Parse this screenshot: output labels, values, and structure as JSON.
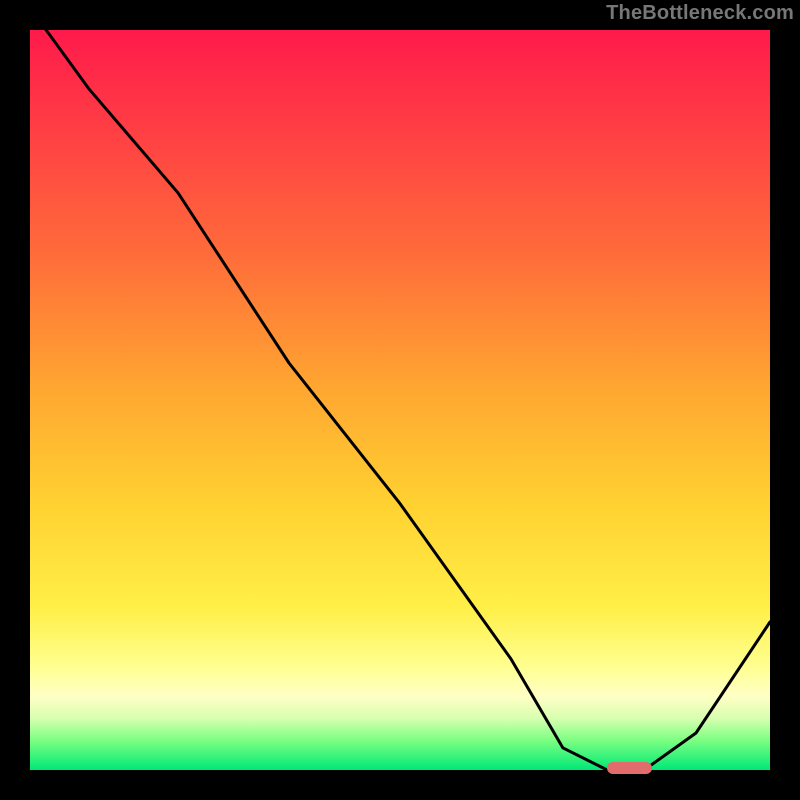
{
  "watermark": "TheBottleneck.com",
  "colors": {
    "background": "#000000",
    "gradient_top": "#ff1a4b",
    "gradient_mid1": "#ff6b3a",
    "gradient_mid2": "#ffd131",
    "gradient_mid3": "#ffff90",
    "gradient_bottom": "#00e876",
    "curve": "#000000",
    "marker": "#e26b6b"
  },
  "chart_data": {
    "type": "line",
    "title": "",
    "xlabel": "",
    "ylabel": "",
    "xlim": [
      0,
      100
    ],
    "ylim": [
      0,
      100
    ],
    "legend": false,
    "grid": false,
    "series": [
      {
        "name": "bottleneck-curve",
        "x": [
          0,
          8,
          20,
          35,
          50,
          65,
          72,
          78,
          83,
          90,
          100
        ],
        "values": [
          103,
          92,
          78,
          55,
          36,
          15,
          3,
          0,
          0,
          5,
          20
        ]
      }
    ],
    "marker": {
      "x_start": 78,
      "x_end": 84,
      "y": 0
    }
  }
}
